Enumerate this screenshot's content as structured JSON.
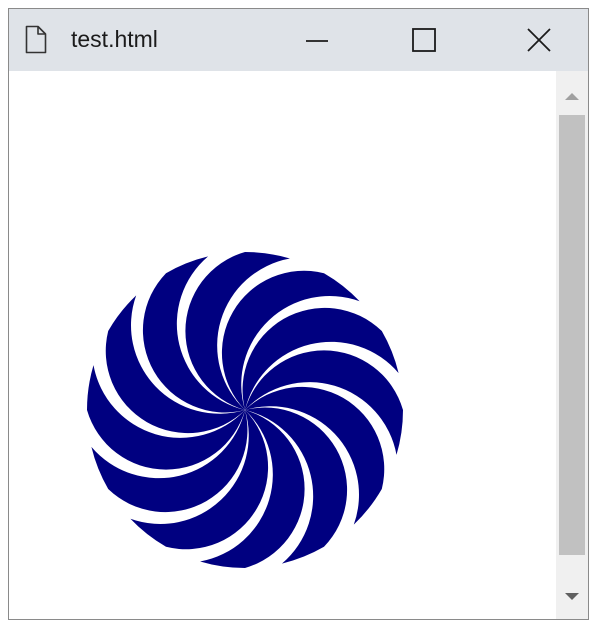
{
  "window": {
    "title": "test.html",
    "title_icon": "document-icon"
  },
  "controls": {
    "minimize_icon": "minimize-icon",
    "maximize_icon": "maximize-icon",
    "close_icon": "close-icon"
  },
  "drawing": {
    "fill_color": "#000080",
    "background_color": "#ffffff",
    "petal_count": 12
  },
  "scrollbar": {
    "up_icon": "scroll-up-arrow-icon",
    "down_icon": "scroll-down-arrow-icon"
  },
  "colors": {
    "titlebar": "#dfe3e8",
    "scrollbar_track": "#f0f0f0",
    "scrollbar_thumb": "#c1c1c1"
  }
}
